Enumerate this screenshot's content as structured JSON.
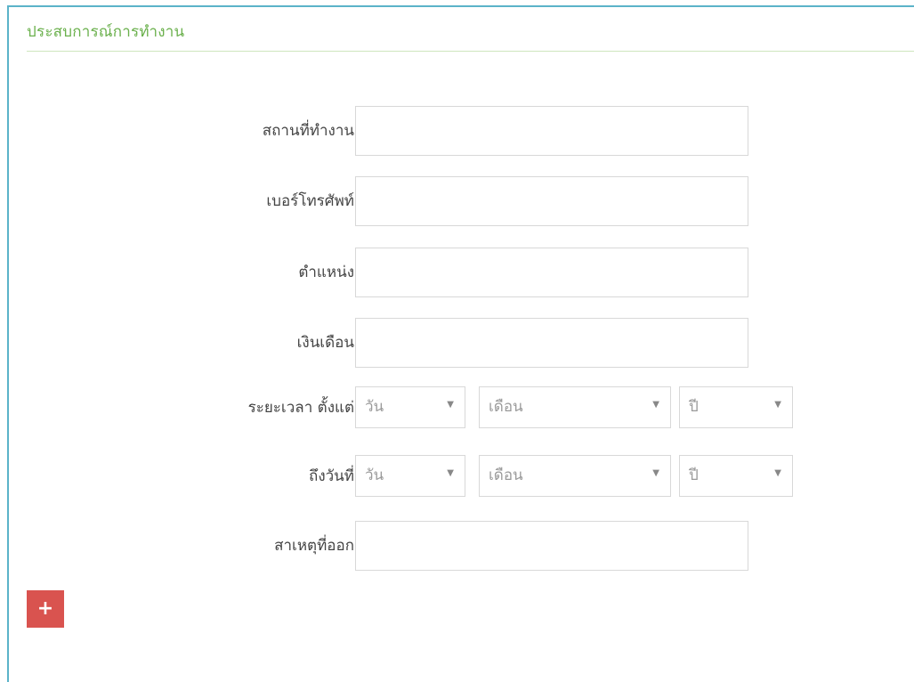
{
  "section": {
    "title": "ประสบการณ์การทำงาน"
  },
  "fields": {
    "workplace_label": "สถานที่ทำงาน",
    "workplace_value": "",
    "phone_label": "เบอร์โทรศัพท์",
    "phone_value": "",
    "position_label": "ตำแหน่ง",
    "position_value": "",
    "salary_label": "เงินเดือน",
    "salary_value": "",
    "period_from_label": "ระยะเวลา ตั้งแต่",
    "period_to_label": "ถึงวันที่",
    "reason_label": "สาเหตุที่ออก",
    "reason_value": ""
  },
  "date_selects": {
    "day_placeholder": "วัน",
    "month_placeholder": "เดือน",
    "year_placeholder": "ปี",
    "caret": "▼"
  },
  "actions": {
    "add_label": "+"
  },
  "colors": {
    "title": "#6ab04c",
    "panel_border": "#5bb3c9",
    "add_button": "#d9534f"
  }
}
